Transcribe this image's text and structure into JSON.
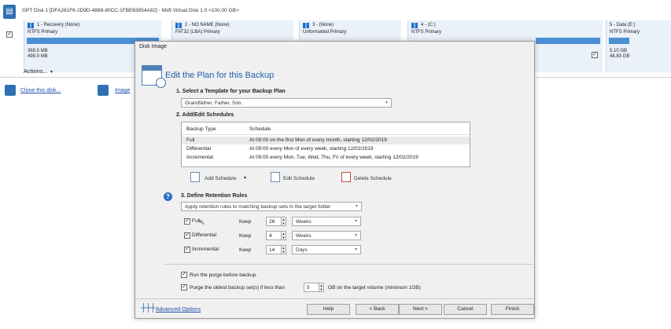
{
  "disk": {
    "title": "GPT Disk 1 [DFA261F6-2D9D-4888-80CC-1FBE63954A62] - Msft Virtual Disk 1.0 <100.00 GB>",
    "partitions": [
      {
        "name": "1 - Recovery (None)",
        "type": "NTFS Primary",
        "size1": "369.5 MB",
        "size2": "499.0 MB"
      },
      {
        "name": "2 - NO NAME (None)",
        "type": "FAT32 (LBA) Primary",
        "size1": "",
        "size2": ""
      },
      {
        "name": "3 - (None)",
        "type": "Unformatted Primary",
        "size1": "",
        "size2": ""
      },
      {
        "name": "4 - (C:)",
        "type": "NTFS Primary",
        "size1": "",
        "size2": ""
      },
      {
        "name": "5 - Data (E:)",
        "type": "NTFS Primary",
        "size1": "5.10 GB",
        "size2": "48.83 GB"
      }
    ],
    "actions_label": "Actions...",
    "actions_arrow": "▼",
    "clone_label": "Clone this disk...",
    "image_label": "Image"
  },
  "dialog": {
    "window_title": "Disk Image",
    "heading": "Edit the Plan for this Backup",
    "section1": "1. Select a Template for your Backup Plan",
    "template_value": "Grandfather, Father, Son.",
    "section2": "2. Add/Edit Schedules",
    "table_headers": [
      "Backup Type",
      "Schedule"
    ],
    "table_rows": [
      {
        "type": "Full",
        "schedule": "At 09:00 on the first Mon of every month, starting 12/02/2019"
      },
      {
        "type": "Differential",
        "schedule": "At 09:00 every Mon of every week, starting 12/02/2019"
      },
      {
        "type": "Incremental",
        "schedule": "At 09:00 every Mon, Tue, Wed, Thu, Fri of every week, starting 12/02/2019"
      }
    ],
    "add_schedule": "Add Schedule",
    "edit_schedule": "Edit Schedule",
    "delete_schedule": "Delete Schedule",
    "section3": "3. Define Retention Rules",
    "retention_mode": "Apply retention rules to matching backup sets in the target folder",
    "keep_label": "Keep",
    "rules": [
      {
        "label": "Full",
        "value": "26",
        "unit": "Weeks"
      },
      {
        "label": "Differential",
        "value": "4",
        "unit": "Weeks"
      },
      {
        "label": "Incremental",
        "value": "14",
        "unit": "Days"
      }
    ],
    "purge_before": "Run the purge before backup.",
    "purge_oldest": "Purge the oldest backup set(s) if less than",
    "purge_value": "5",
    "purge_suffix": "GB on the target volume (minimum 1GB)",
    "advanced": "Advanced Options",
    "buttons": {
      "help": "Help",
      "back": "< Back",
      "next": "Next >",
      "cancel": "Cancel",
      "finish": "Finish"
    }
  },
  "colors": {
    "accent": "#1e5fa8",
    "partition_bar": "#4a8fd4",
    "link": "#1f4ea8"
  }
}
